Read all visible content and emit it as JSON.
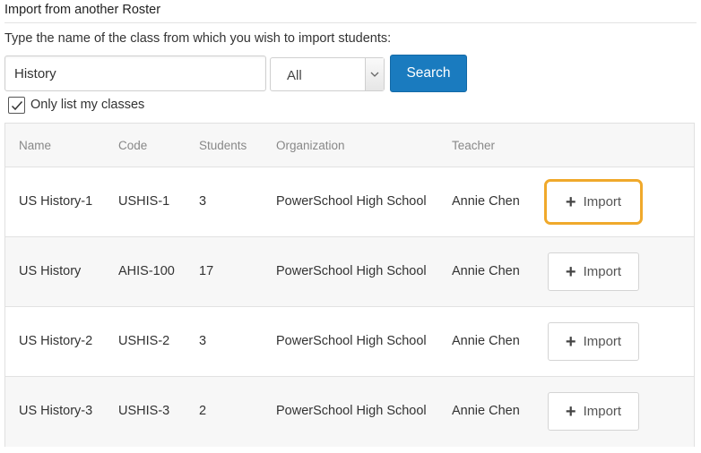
{
  "header": {
    "title": "Import from another Roster"
  },
  "search": {
    "instruction": "Type the name of the class from which you wish to import students:",
    "query": "History",
    "filter_selected": "All",
    "button_label": "Search"
  },
  "filter": {
    "only_my_classes_label": "Only list my classes",
    "checked": true
  },
  "table": {
    "columns": {
      "name": "Name",
      "code": "Code",
      "students": "Students",
      "organization": "Organization",
      "teacher": "Teacher"
    },
    "rows": [
      {
        "name": "US History-1",
        "code": "USHIS-1",
        "students": "3",
        "organization": "PowerSchool High School",
        "teacher": "Annie Chen",
        "action": "Import"
      },
      {
        "name": "US History",
        "code": "AHIS-100",
        "students": "17",
        "organization": "PowerSchool High School",
        "teacher": "Annie Chen",
        "action": "Import"
      },
      {
        "name": "US History-2",
        "code": "USHIS-2",
        "students": "3",
        "organization": "PowerSchool High School",
        "teacher": "Annie Chen",
        "action": "Import"
      },
      {
        "name": "US History-3",
        "code": "USHIS-3",
        "students": "2",
        "organization": "PowerSchool High School",
        "teacher": "Annie Chen",
        "action": "Import"
      }
    ]
  },
  "colors": {
    "accent": "#1a7bbf",
    "highlight": "#f0a92b"
  },
  "icons": {
    "import": "plus-icon",
    "check": "checkmark-icon",
    "select_arrow": "chevron-down-icon"
  }
}
